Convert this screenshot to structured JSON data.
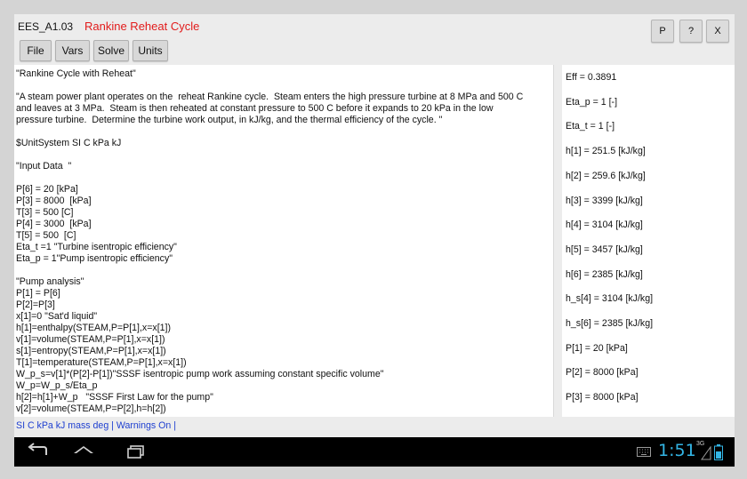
{
  "app": {
    "title": "EES_A1.03",
    "document_title": "Rankine Reheat Cycle",
    "top_buttons": [
      "P",
      "?",
      "X"
    ]
  },
  "toolbar": {
    "file_label": "File",
    "vars_label": "Vars",
    "solve_label": "Solve",
    "units_label": "Units"
  },
  "editor": {
    "lines": [
      "\"Rankine Cycle with Reheat\"",
      "",
      "\"A steam power plant operates on the  reheat Rankine cycle.  Steam enters the high pressure turbine at 8 MPa and 500 C",
      "and leaves at 3 MPa.  Steam is then reheated at constant pressure to 500 C before it expands to 20 kPa in the low",
      "pressure turbine.  Determine the turbine work output, in kJ/kg, and the thermal efficiency of the cycle. \"",
      "",
      "$UnitSystem SI C kPa kJ",
      "",
      "\"Input Data  \"",
      "",
      "P[6] = 20 [kPa]",
      "P[3] = 8000  [kPa]",
      "T[3] = 500 [C]",
      "P[4] = 3000  [kPa]",
      "T[5] = 500  [C]",
      "Eta_t =1 \"Turbine isentropic efficiency\"",
      "Eta_p = 1\"Pump isentropic efficiency\"",
      "",
      "\"Pump analysis\"",
      "P[1] = P[6]",
      "P[2]=P[3]",
      "x[1]=0 \"Sat'd liquid\"",
      "h[1]=enthalpy(STEAM,P=P[1],x=x[1])",
      "v[1]=volume(STEAM,P=P[1],x=x[1])",
      "s[1]=entropy(STEAM,P=P[1],x=x[1])",
      "T[1]=temperature(STEAM,P=P[1],x=x[1])",
      "W_p_s=v[1]*(P[2]-P[1])\"SSSF isentropic pump work assuming constant specific volume\"",
      "W_p=W_p_s/Eta_p",
      "h[2]=h[1]+W_p   \"SSSF First Law for the pump\"",
      "v[2]=volume(STEAM,P=P[2],h=h[2])"
    ]
  },
  "results": [
    "Eff = 0.3891",
    "Eta_p = 1 [-]",
    "Eta_t = 1 [-]",
    "h[1] = 251.5 [kJ/kg]",
    "h[2] = 259.6 [kJ/kg]",
    "h[3] = 3399 [kJ/kg]",
    "h[4] = 3104 [kJ/kg]",
    "h[5] = 3457 [kJ/kg]",
    "h[6] = 2385 [kJ/kg]",
    "h_s[4] = 3104 [kJ/kg]",
    "h_s[6] = 2385 [kJ/kg]",
    "P[1] = 20 [kPa]",
    "P[2] = 8000 [kPa]",
    "P[3] = 8000 [kPa]"
  ],
  "status": {
    "text": "SI C kPa kJ mass deg  | Warnings On |"
  },
  "system": {
    "clock": "1:51",
    "network": "3G",
    "icons": [
      "back-icon",
      "home-icon",
      "recent-apps-icon",
      "keyboard-icon",
      "signal-icon",
      "battery-icon"
    ]
  },
  "colors": {
    "document_title": "#e21b1b",
    "status_text": "#1e3fd0",
    "clock": "#33b5e5"
  }
}
